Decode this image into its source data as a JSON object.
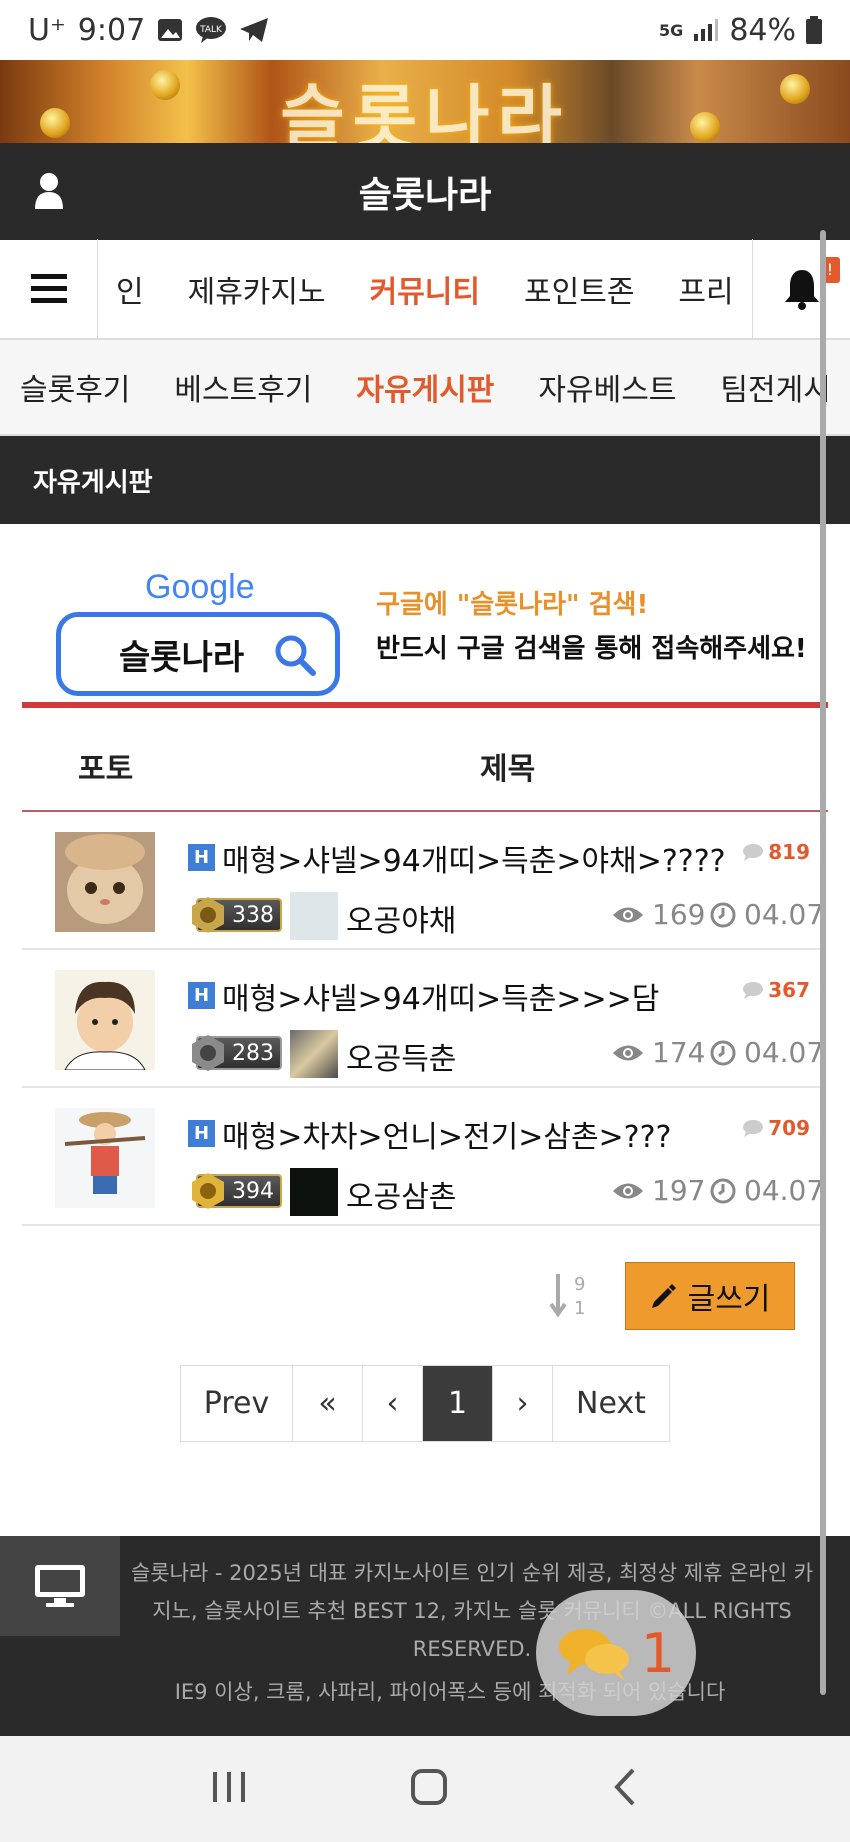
{
  "status_bar": {
    "carrier": "U⁺",
    "time": "9:07",
    "network": "5G",
    "battery": "84%"
  },
  "banner": {
    "text": "슬롯나라"
  },
  "header": {
    "title": "슬롯나라"
  },
  "main_nav": {
    "items": [
      {
        "label": "인",
        "active": false
      },
      {
        "label": "제휴카지노",
        "active": false
      },
      {
        "label": "커뮤니티",
        "active": true
      },
      {
        "label": "포인트존",
        "active": false
      },
      {
        "label": "프리",
        "active": false
      }
    ],
    "notification_badge": "!"
  },
  "sub_nav": {
    "items": [
      {
        "label": "슬롯후기",
        "active": false
      },
      {
        "label": "베스트후기",
        "active": false
      },
      {
        "label": "자유게시판",
        "active": true
      },
      {
        "label": "자유베스트",
        "active": false
      },
      {
        "label": "팀전게시",
        "active": false
      }
    ]
  },
  "board": {
    "title": "자유게시판"
  },
  "promo": {
    "google_logo": "Google",
    "search_query": "슬롯나라",
    "line1": "구글에 \"슬롯나라\" 검색!",
    "line2": "반드시 구글 검색을 통해 접속해주세요!"
  },
  "table": {
    "headers": {
      "photo": "포토",
      "subject": "제목"
    },
    "rows": [
      {
        "badge": "H",
        "title": "매형>샤넬>94개띠>득춘>야채>????",
        "comments": "819",
        "level": "338",
        "author": "오공야채",
        "views": "169",
        "date": "04.07"
      },
      {
        "badge": "H",
        "title": "매형>샤넬>94개띠>득춘>>>담",
        "comments": "367",
        "level": "283",
        "author": "오공득춘",
        "views": "174",
        "date": "04.07"
      },
      {
        "badge": "H",
        "title": "매형>차차>언니>전기>삼촌>???",
        "comments": "709",
        "level": "394",
        "author": "오공삼촌",
        "views": "197",
        "date": "04.07"
      }
    ]
  },
  "actions": {
    "sort_top": "9",
    "sort_bottom": "1",
    "write_label": "글쓰기"
  },
  "pagination": {
    "prev": "Prev",
    "first": "«",
    "prev_arrow": "‹",
    "current": "1",
    "next_arrow": "›",
    "next": "Next"
  },
  "footer": {
    "text": "슬롯나라 - 2025년 대표 카지노사이트 인기 순위 제공, 최정상 제휴 온라인 카지노, 슬롯사이트 추천 BEST 12, 카지노 슬롯 커뮤니티 ©ALL RIGHTS RESERVED.",
    "compat": "IE9 이상, 크롬, 사파리, 파이어폭스 등에 최적화 되어 있습니다",
    "chat_count": "1"
  },
  "colors": {
    "accent": "#e25a2b",
    "dark": "#2b2a2a",
    "write": "#ef9a2c",
    "hot": "#3e7ed8"
  }
}
